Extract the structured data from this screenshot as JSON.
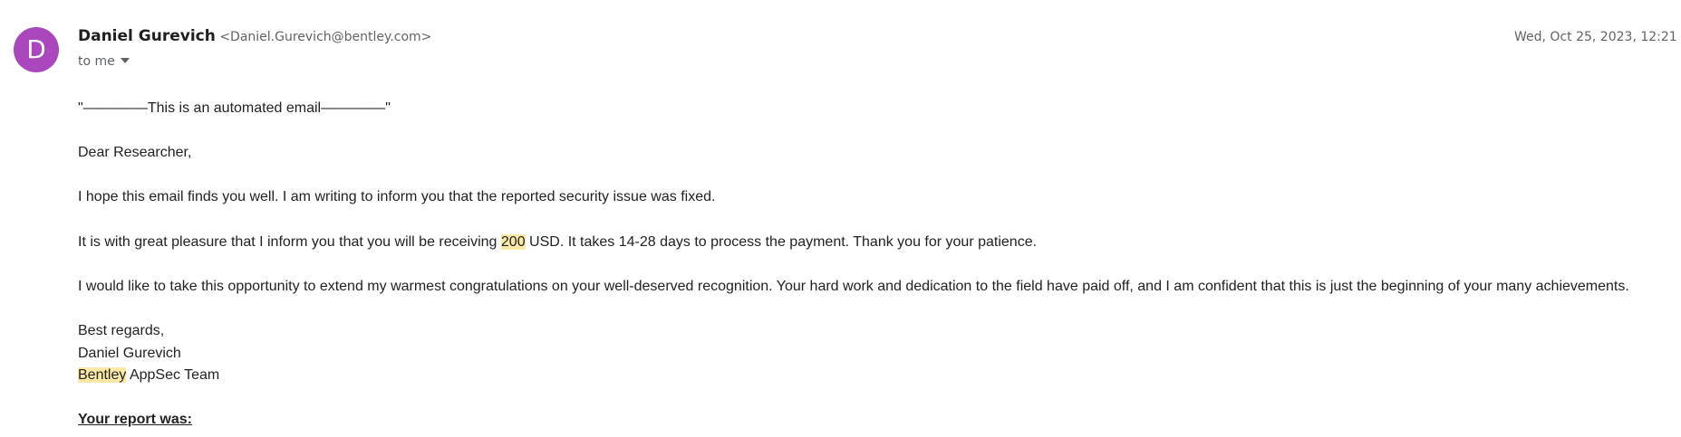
{
  "sender": {
    "avatar_letter": "D",
    "avatar_color": "#ab47bc",
    "name": "Daniel Gurevich",
    "email": "<Daniel.Gurevich@bentley.com>"
  },
  "recipient": {
    "label": "to me"
  },
  "date": "Wed, Oct 25, 2023, 12:21 PM",
  "body": {
    "automated_notice": "\"––––––––This is an automated email––––––––\"",
    "greeting": "Dear Researcher,",
    "para1": "I hope this email finds you well. I am writing to inform you that the reported security issue was fixed.",
    "para2_before": "It is with great pleasure that I inform you that you will be receiving ",
    "para2_amount": "200",
    "para2_after": " USD. It takes 14-28 days to process the payment. Thank you for your patience.",
    "para3": "I would like to take this opportunity to extend my warmest congratulations on your well-deserved recognition. Your hard work and dedication to the field have paid off, and I am confident that this is just the beginning of your many achievements.",
    "signoff": "Best regards,",
    "signature_name": "Daniel Gurevich",
    "signature_company": "Bentley",
    "signature_team": " AppSec Team",
    "report_heading": "Your report was:"
  },
  "colors": {
    "highlight": "#fce8a6",
    "secondary_text": "#5f6368"
  }
}
